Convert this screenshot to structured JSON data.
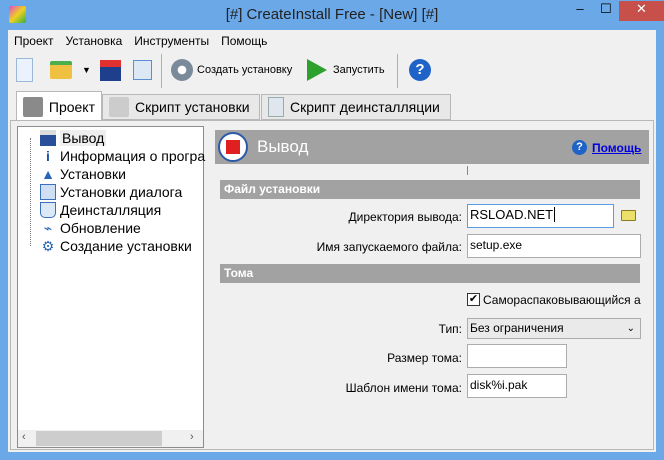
{
  "window": {
    "title": "[#] CreateInstall Free - [New] [#]",
    "minimize": "–",
    "maximize": "☐",
    "close": "✕",
    "accent": "#6ba8e8",
    "close_color": "#c7504b"
  },
  "menu": [
    "Проект",
    "Установка",
    "Инструменты",
    "Помощь"
  ],
  "toolbar": {
    "build": "Создать установку",
    "run": "Запустить"
  },
  "tabs": [
    "Проект",
    "Скрипт установки",
    "Скрипт деинсталляции"
  ],
  "tree": [
    "Вывод",
    "Информация о програ",
    "Установки",
    "Установки диалога",
    "Деинсталляция",
    "Обновление",
    "Создание установки"
  ],
  "header": {
    "title": "Вывод",
    "help": "Помощь"
  },
  "sections": {
    "file": "Файл установки",
    "volumes": "Тома"
  },
  "fields": {
    "output_dir_label": "Директория вывода:",
    "output_dir": "RSLOAD.NET",
    "exe_label": "Имя запускаемого файла:",
    "exe": "setup.exe",
    "sfx_label": "Самораспаковывающийся арх",
    "type_label": "Тип:",
    "type": "Без ограничения",
    "size_label": "Размер тома:",
    "size": "",
    "template_label": "Шаблон имени тома:",
    "template": "disk%i.pak"
  }
}
